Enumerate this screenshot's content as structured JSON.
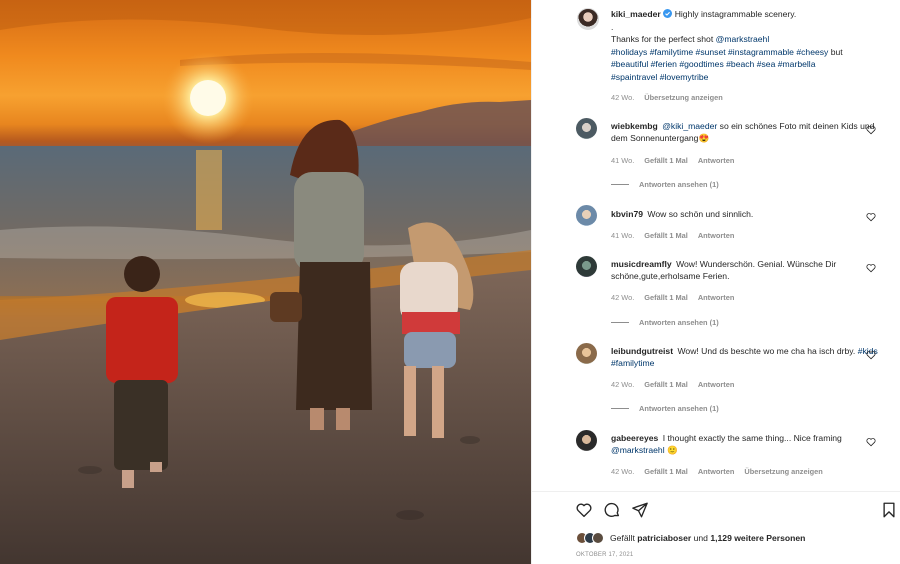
{
  "post": {
    "username": "kiki_maeder",
    "caption_lead": "Highly instagrammable scenery.",
    "caption_dot": ".",
    "caption_thanks": "Thanks for the perfect shot",
    "caption_mention": "@markstraehl",
    "hashtags_line1": "#holidays #familytime #sunset #instagrammable #cheesy",
    "caption_but": "but",
    "hashtags_line2": "#beautiful #ferien #goodtimes #beach #sea #marbella",
    "hashtags_line3": "#spaintravel #lovemytribe",
    "time": "42 Wo.",
    "translate": "Übersetzung anzeigen"
  },
  "comments": [
    {
      "username": "wiebkembg",
      "mention": "@kiki_maeder",
      "text": "so ein schönes Foto mit deinen Kids und dem Sonnenuntergang😍",
      "time": "41 Wo.",
      "likes": "Gefällt 1 Mal",
      "reply": "Antworten",
      "replies": "Antworten ansehen (1)"
    },
    {
      "username": "kbvin79",
      "text": "Wow so schön und sinnlich.",
      "time": "41 Wo.",
      "likes": "Gefällt 1 Mal",
      "reply": "Antworten"
    },
    {
      "username": "musicdreamfly",
      "text": "Wow! Wunderschön. Genial. Wünsche Dir schöne,gute,erholsame Ferien.",
      "time": "42 Wo.",
      "likes": "Gefällt 1 Mal",
      "reply": "Antworten",
      "replies": "Antworten ansehen (1)"
    },
    {
      "username": "leibundgutreist",
      "text": "Wow! Und ds beschte wo me cha ha isch drby.",
      "tags": "#kids #familytime",
      "time": "42 Wo.",
      "likes": "Gefällt 1 Mal",
      "reply": "Antworten",
      "replies": "Antworten ansehen (1)"
    },
    {
      "username": "gabeereyes",
      "text": "I thought exactly the same thing... Nice framing",
      "mention": "@markstraehl",
      "emoji": "🙂",
      "time": "42 Wo.",
      "likes": "Gefällt 1 Mal",
      "reply": "Antworten",
      "translate": "Übersetzung anzeigen"
    }
  ],
  "footer": {
    "liked_prefix": "Gefällt",
    "liked_user": "patriciaboser",
    "liked_and": "und",
    "liked_others": "1,129 weitere Personen",
    "date": "OKTOBER 17, 2021"
  },
  "icons": [
    "heart-icon",
    "comment-icon",
    "share-icon",
    "bookmark-icon",
    "verified-badge-icon"
  ],
  "colors": {
    "link": "#00376b",
    "secondary_text": "#8e8e8e",
    "verified": "#3897f0"
  }
}
